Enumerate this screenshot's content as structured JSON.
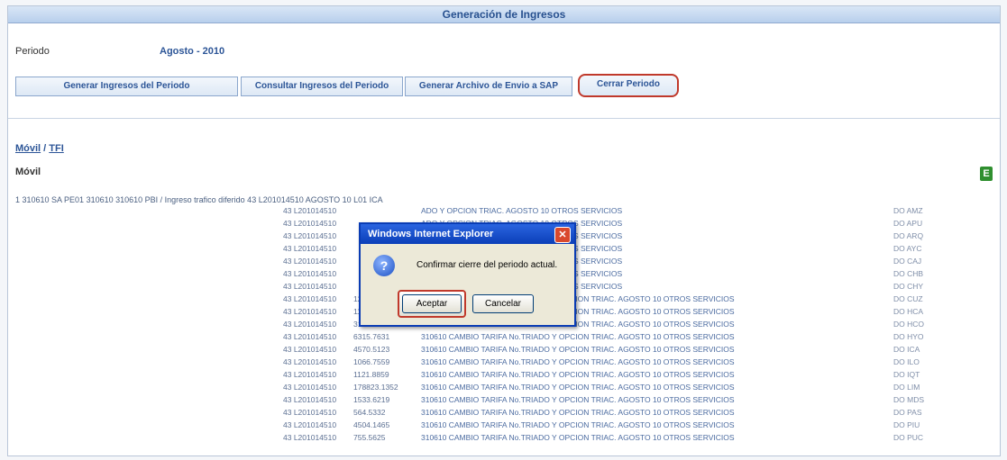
{
  "header": {
    "title": "Generación de Ingresos"
  },
  "periodo": {
    "label": "Periodo",
    "value": "Agosto - 2010"
  },
  "buttons": [
    "Generar Ingresos del Periodo",
    "Consultar Ingresos del Periodo",
    "Generar Archivo de Envio a SAP",
    "Cerrar Periodo"
  ],
  "tabs": {
    "movil": "Móvil",
    "separator": " / ",
    "tfi": "TFI"
  },
  "section": {
    "title": "Móvil"
  },
  "table": {
    "header_line": "1 310610 SA PE01 310610 310610 PBI / Ingreso trafico diferido 43 L201014510 AGOSTO 10 L01 ICA",
    "rows": [
      {
        "c2": "43 L201014510",
        "c3": "",
        "c4": "ADO Y OPCION TRIAC. AGOSTO 10 OTROS SERVICIOS",
        "c6": "DO AMZ"
      },
      {
        "c2": "43 L201014510",
        "c3": "",
        "c4": "ADO Y OPCION TRIAC. AGOSTO 10 OTROS SERVICIOS",
        "c6": "DO APU"
      },
      {
        "c2": "43 L201014510",
        "c3": "",
        "c4": "ADO Y OPCION TRIAC. AGOSTO 10 OTROS SERVICIOS",
        "c6": "DO ARQ"
      },
      {
        "c2": "43 L201014510",
        "c3": "",
        "c4": "ADO Y OPCION TRIAC. AGOSTO 10 OTROS SERVICIOS",
        "c6": "DO AYC"
      },
      {
        "c2": "43 L201014510",
        "c3": "",
        "c4": "ADO Y OPCION TRIAC. AGOSTO 10 OTROS SERVICIOS",
        "c6": "DO CAJ"
      },
      {
        "c2": "43 L201014510",
        "c3": "",
        "c4": "ADO Y OPCION TRIAC. AGOSTO 10 OTROS SERVICIOS",
        "c6": "DO CHB"
      },
      {
        "c2": "43 L201014510",
        "c3": "",
        "c4": "ADO Y OPCION TRIAC. AGOSTO 10 OTROS SERVICIOS",
        "c6": "DO CHY"
      },
      {
        "c2": "43 L201014510",
        "c3": "124902.599",
        "c4": "310610 CAMBIO TARIFA No.TRIADO Y OPCION TRIAC. AGOSTO 10 OTROS SERVICIOS",
        "c6": "DO CUZ"
      },
      {
        "c2": "43 L201014510",
        "c3": "1116.4534",
        "c4": "310610 CAMBIO TARIFA No.TRIADO Y OPCION TRIAC. AGOSTO 10 OTROS SERVICIOS",
        "c6": "DO HCA"
      },
      {
        "c2": "43 L201014510",
        "c3": "3160.0558",
        "c4": "310610 CAMBIO TARIFA No.TRIADO Y OPCION TRIAC. AGOSTO 10 OTROS SERVICIOS",
        "c6": "DO HCO"
      },
      {
        "c2": "43 L201014510",
        "c3": "6315.7631",
        "c4": "310610 CAMBIO TARIFA No.TRIADO Y OPCION TRIAC. AGOSTO 10 OTROS SERVICIOS",
        "c6": "DO HYO"
      },
      {
        "c2": "43 L201014510",
        "c3": "4570.5123",
        "c4": "310610 CAMBIO TARIFA No.TRIADO Y OPCION TRIAC. AGOSTO 10 OTROS SERVICIOS",
        "c6": "DO ICA"
      },
      {
        "c2": "43 L201014510",
        "c3": "1066.7559",
        "c4": "310610 CAMBIO TARIFA No.TRIADO Y OPCION TRIAC. AGOSTO 10 OTROS SERVICIOS",
        "c6": "DO ILO"
      },
      {
        "c2": "43 L201014510",
        "c3": "1121.8859",
        "c4": "310610 CAMBIO TARIFA No.TRIADO Y OPCION TRIAC. AGOSTO 10 OTROS SERVICIOS",
        "c6": "DO IQT"
      },
      {
        "c2": "43 L201014510",
        "c3": "178823.1352",
        "c4": "310610 CAMBIO TARIFA No.TRIADO Y OPCION TRIAC. AGOSTO 10 OTROS SERVICIOS",
        "c6": "DO LIM"
      },
      {
        "c2": "43 L201014510",
        "c3": "1533.6219",
        "c4": "310610 CAMBIO TARIFA No.TRIADO Y OPCION TRIAC. AGOSTO 10 OTROS SERVICIOS",
        "c6": "DO MDS"
      },
      {
        "c2": "43 L201014510",
        "c3": "564.5332",
        "c4": "310610 CAMBIO TARIFA No.TRIADO Y OPCION TRIAC. AGOSTO 10 OTROS SERVICIOS",
        "c6": "DO PAS"
      },
      {
        "c2": "43 L201014510",
        "c3": "4504.1465",
        "c4": "310610 CAMBIO TARIFA No.TRIADO Y OPCION TRIAC. AGOSTO 10 OTROS SERVICIOS",
        "c6": "DO PIU"
      },
      {
        "c2": "43 L201014510",
        "c3": "755.5625",
        "c4": "310610 CAMBIO TARIFA No.TRIADO Y OPCION TRIAC. AGOSTO 10 OTROS SERVICIOS",
        "c6": "DO PUC"
      }
    ]
  },
  "dialog": {
    "title": "Windows Internet Explorer",
    "message": "Confirmar cierre del periodo actual.",
    "ok": "Aceptar",
    "cancel": "Cancelar",
    "icon": "question-icon"
  },
  "colors": {
    "accent": "#2c5597",
    "highlight_ring": "#c0392b",
    "dialog_title": "#0b3fb8"
  }
}
